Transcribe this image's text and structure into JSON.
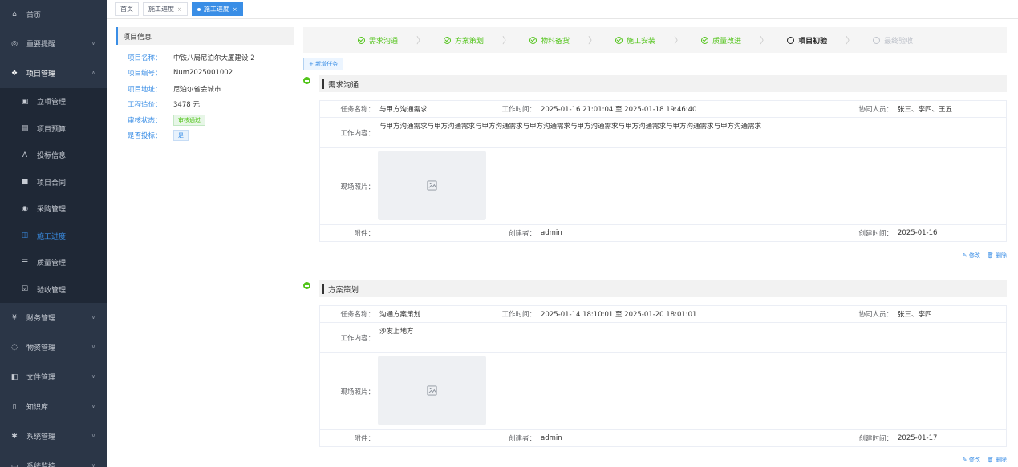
{
  "sidebar": {
    "items": [
      {
        "label": "首页",
        "icon": "home-icon"
      },
      {
        "label": "重要提醒",
        "icon": "bell-icon"
      },
      {
        "label": "项目管理",
        "icon": "project-icon"
      },
      {
        "label": "财务管理",
        "icon": "finance-icon"
      },
      {
        "label": "物资管理",
        "icon": "materials-icon"
      },
      {
        "label": "文件管理",
        "icon": "file-icon"
      },
      {
        "label": "知识库",
        "icon": "book-icon"
      },
      {
        "label": "系统管理",
        "icon": "settings-icon"
      },
      {
        "label": "系统监控",
        "icon": "monitor-icon"
      }
    ],
    "sub_items": [
      {
        "label": "立项管理",
        "icon": "approval-icon"
      },
      {
        "label": "项目预算",
        "icon": "budget-icon"
      },
      {
        "label": "投标信息",
        "icon": "bid-icon"
      },
      {
        "label": "项目合同",
        "icon": "contract-icon"
      },
      {
        "label": "采购管理",
        "icon": "purchase-icon"
      },
      {
        "label": "施工进度",
        "icon": "progress-icon"
      },
      {
        "label": "质量管理",
        "icon": "quality-icon"
      },
      {
        "label": "验收管理",
        "icon": "acceptance-icon"
      }
    ]
  },
  "tabs": [
    {
      "label": "首页"
    },
    {
      "label": "施工进度"
    },
    {
      "label": "施工进度"
    }
  ],
  "info": {
    "title": "项目信息",
    "rows": [
      {
        "key": "项目名称：",
        "value": "中铁八局尼泊尔大厦建设 2"
      },
      {
        "key": "项目编号：",
        "value": "Num2025001002"
      },
      {
        "key": "项目地址：",
        "value": "尼泊尔省会城市"
      },
      {
        "key": "工程造价：",
        "value": "3478 元"
      },
      {
        "key": "审核状态：",
        "value": "审核通过"
      },
      {
        "key": "是否投标：",
        "value": "是"
      }
    ]
  },
  "steps": [
    {
      "label": "需求沟通",
      "state": "done"
    },
    {
      "label": "方案策划",
      "state": "done"
    },
    {
      "label": "物料备货",
      "state": "done"
    },
    {
      "label": "施工安装",
      "state": "done"
    },
    {
      "label": "质量改进",
      "state": "done"
    },
    {
      "label": "项目初验",
      "state": "current"
    },
    {
      "label": "最终验收",
      "state": "future"
    }
  ],
  "add_task_label": "+ 新增任务",
  "sections": [
    {
      "title": "需求沟通",
      "task_name_label": "任务名称：",
      "task_name": "与甲方沟通需求",
      "work_time_label": "工作时间：",
      "work_time": "2025-01-16 21:01:04 至 2025-01-18 19:46:40",
      "collab_label": "协同人员：",
      "collab": "张三、李四、王五",
      "content_label": "工作内容：",
      "content": "与甲方沟通需求与甲方沟通需求与甲方沟通需求与甲方沟通需求与甲方沟通需求与甲方沟通需求与甲方沟通需求与甲方沟通需求",
      "photo_label": "现场照片：",
      "attach_label": "附件：",
      "attach": "",
      "creator_label": "创建者：",
      "creator": "admin",
      "created_label": "创建时间：",
      "created": "2025-01-16",
      "edit": "修改",
      "delete": "删除"
    },
    {
      "title": "方案策划",
      "task_name_label": "任务名称：",
      "task_name": "沟通方案策划",
      "work_time_label": "工作时间：",
      "work_time": "2025-01-14 18:10:01 至 2025-01-20 18:01:01",
      "collab_label": "协同人员：",
      "collab": "张三、李四",
      "content_label": "工作内容：",
      "content": "沙发上地方",
      "photo_label": "现场照片：",
      "attach_label": "附件：",
      "attach": "",
      "creator_label": "创建者：",
      "creator": "admin",
      "created_label": "创建时间：",
      "created": "2025-01-17",
      "edit": "修改",
      "delete": "删除"
    }
  ]
}
